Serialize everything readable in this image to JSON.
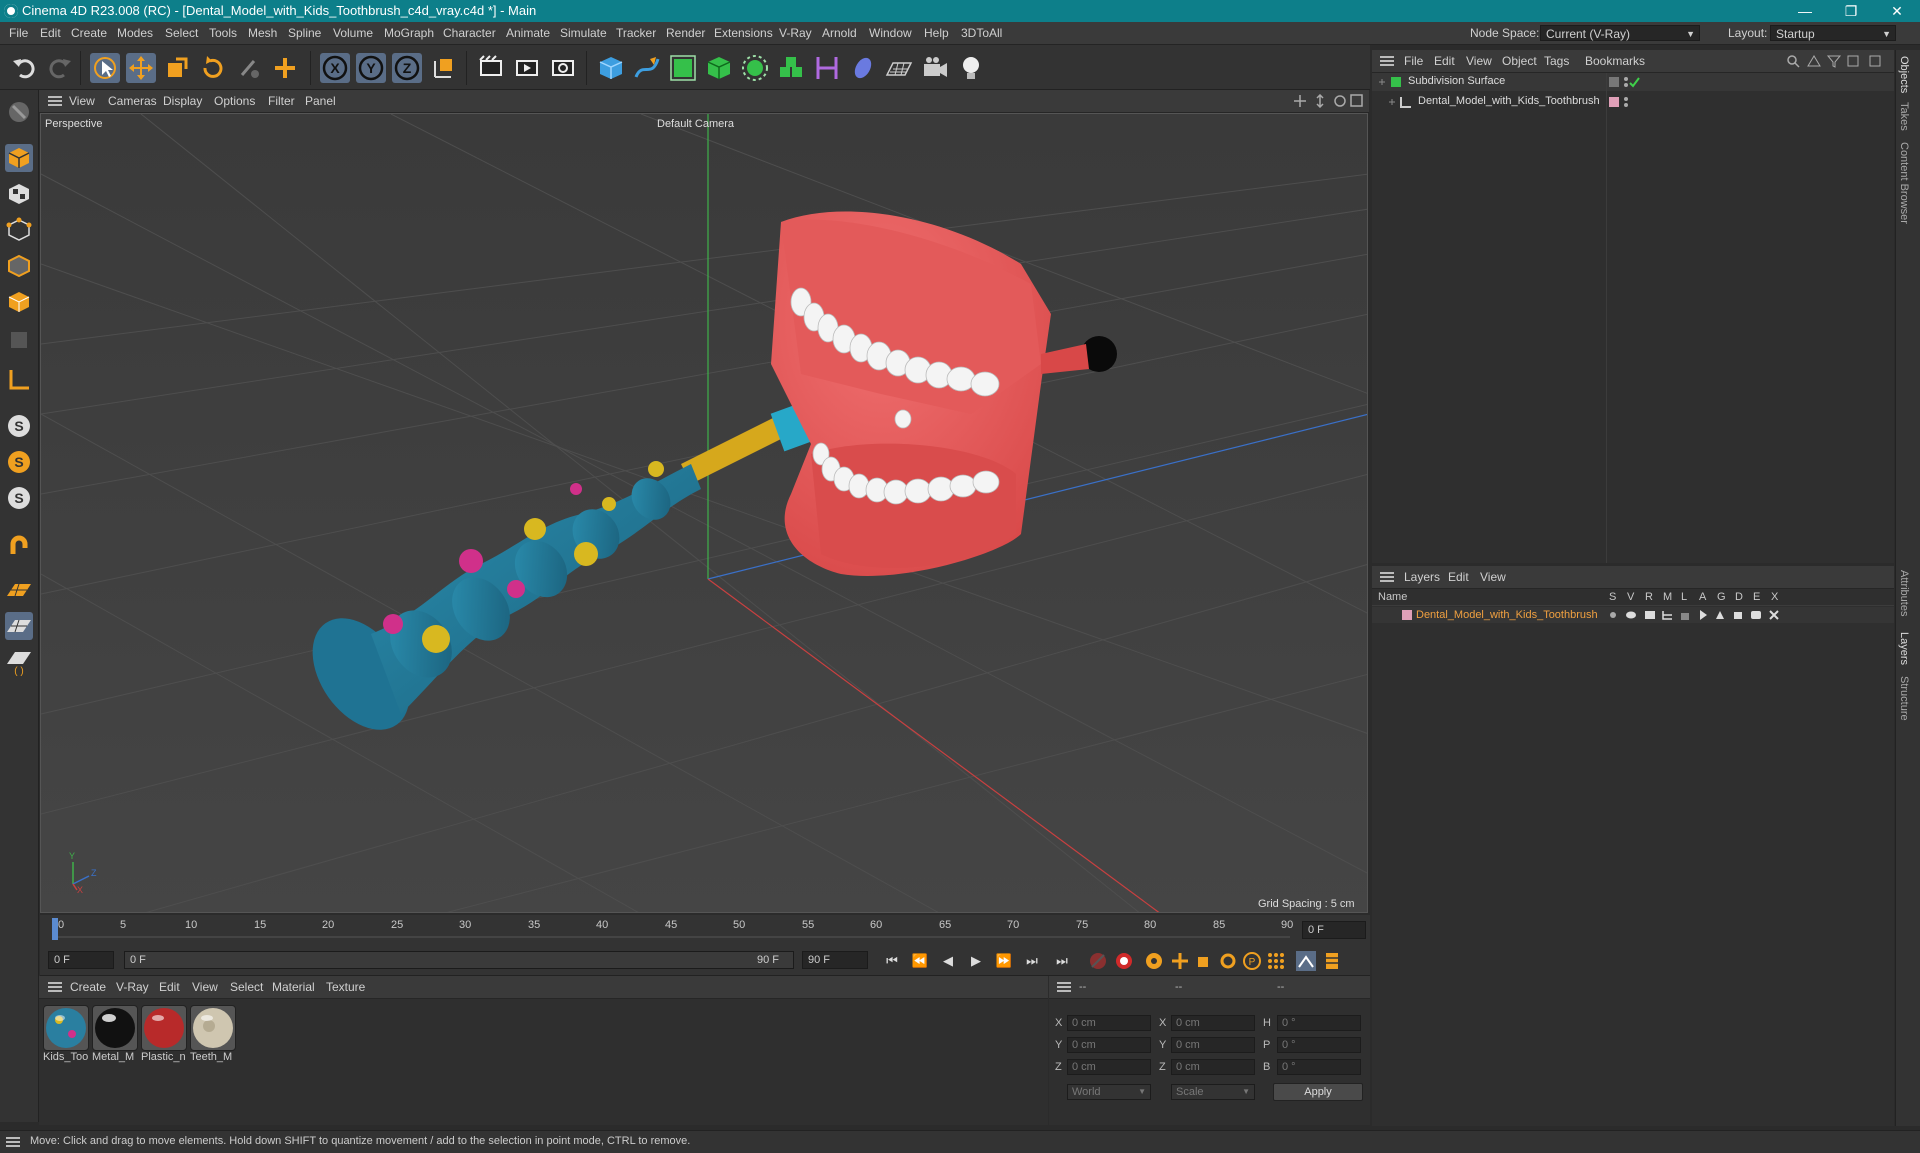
{
  "window": {
    "title": "Cinema 4D R23.008 (RC) - [Dental_Model_with_Kids_Toothbrush_c4d_vray.c4d *] - Main",
    "minimize": "—",
    "restore": "❐",
    "close": "✕"
  },
  "menubar": {
    "items": [
      "File",
      "Edit",
      "Create",
      "Modes",
      "Select",
      "Tools",
      "Mesh",
      "Spline",
      "Volume",
      "MoGraph",
      "Character",
      "Animate",
      "Simulate",
      "Tracker",
      "Render",
      "Extensions",
      "V-Ray",
      "Arnold",
      "Window",
      "Help",
      "3DToAll"
    ],
    "node_space_label": "Node Space:",
    "node_space_value": "Current (V-Ray)",
    "layout_label": "Layout:",
    "layout_value": "Startup"
  },
  "viewport": {
    "menu": [
      "View",
      "Cameras",
      "Display",
      "Options",
      "Filter",
      "Panel"
    ],
    "view_name": "Perspective",
    "camera": "Default Camera",
    "grid_spacing": "Grid Spacing : 5 cm",
    "axis_x": "X",
    "axis_y": "Y",
    "axis_z": "Z"
  },
  "timeline": {
    "ticks": [
      "0",
      "5",
      "10",
      "15",
      "20",
      "25",
      "30",
      "35",
      "40",
      "45",
      "50",
      "55",
      "60",
      "65",
      "70",
      "75",
      "80",
      "85",
      "90"
    ],
    "current_frame": "0 F",
    "start_frame": "0 F",
    "range_start": "0 F",
    "range_end": "90 F",
    "end_frame": "90 F"
  },
  "materials": {
    "menu": [
      "Create",
      "V-Ray",
      "Edit",
      "View",
      "Select",
      "Material",
      "Texture"
    ],
    "items": [
      {
        "name": "Kids_Too",
        "color": "#2a7fa0"
      },
      {
        "name": "Metal_M",
        "color": "#111111"
      },
      {
        "name": "Plastic_n",
        "color": "#b82a2a"
      },
      {
        "name": "Teeth_M",
        "color": "#cfc6b0"
      }
    ]
  },
  "coordinates": {
    "headers": [
      "--",
      "--",
      "--"
    ],
    "rows": [
      {
        "l1": "X",
        "v1": "0 cm",
        "l2": "X",
        "v2": "0 cm",
        "l3": "H",
        "v3": "0 °"
      },
      {
        "l1": "Y",
        "v1": "0 cm",
        "l2": "Y",
        "v2": "0 cm",
        "l3": "P",
        "v3": "0 °"
      },
      {
        "l1": "Z",
        "v1": "0 cm",
        "l2": "Z",
        "v2": "0 cm",
        "l3": "B",
        "v3": "0 °"
      }
    ],
    "mode1": "World",
    "mode2": "Scale",
    "apply": "Apply"
  },
  "objects": {
    "menu": [
      "File",
      "Edit",
      "View",
      "Object",
      "Tags",
      "Bookmarks"
    ],
    "items": [
      {
        "name": "Subdivision Surface"
      },
      {
        "name": "Dental_Model_with_Kids_Toothbrush"
      }
    ]
  },
  "layers": {
    "menu": [
      "Layers",
      "Edit",
      "View"
    ],
    "name_col": "Name",
    "cols": [
      "S",
      "V",
      "R",
      "M",
      "L",
      "A",
      "G",
      "D",
      "E",
      "X"
    ],
    "items": [
      {
        "name": "Dental_Model_with_Kids_Toothbrush",
        "color": "#e0a0b8"
      }
    ]
  },
  "right_tabs": [
    "Objects",
    "Takes",
    "Content Browser",
    "Attributes",
    "Layers",
    "Structure"
  ],
  "status": "Move: Click and drag to move elements. Hold down SHIFT to quantize movement / add to the selection in point mode, CTRL to remove."
}
